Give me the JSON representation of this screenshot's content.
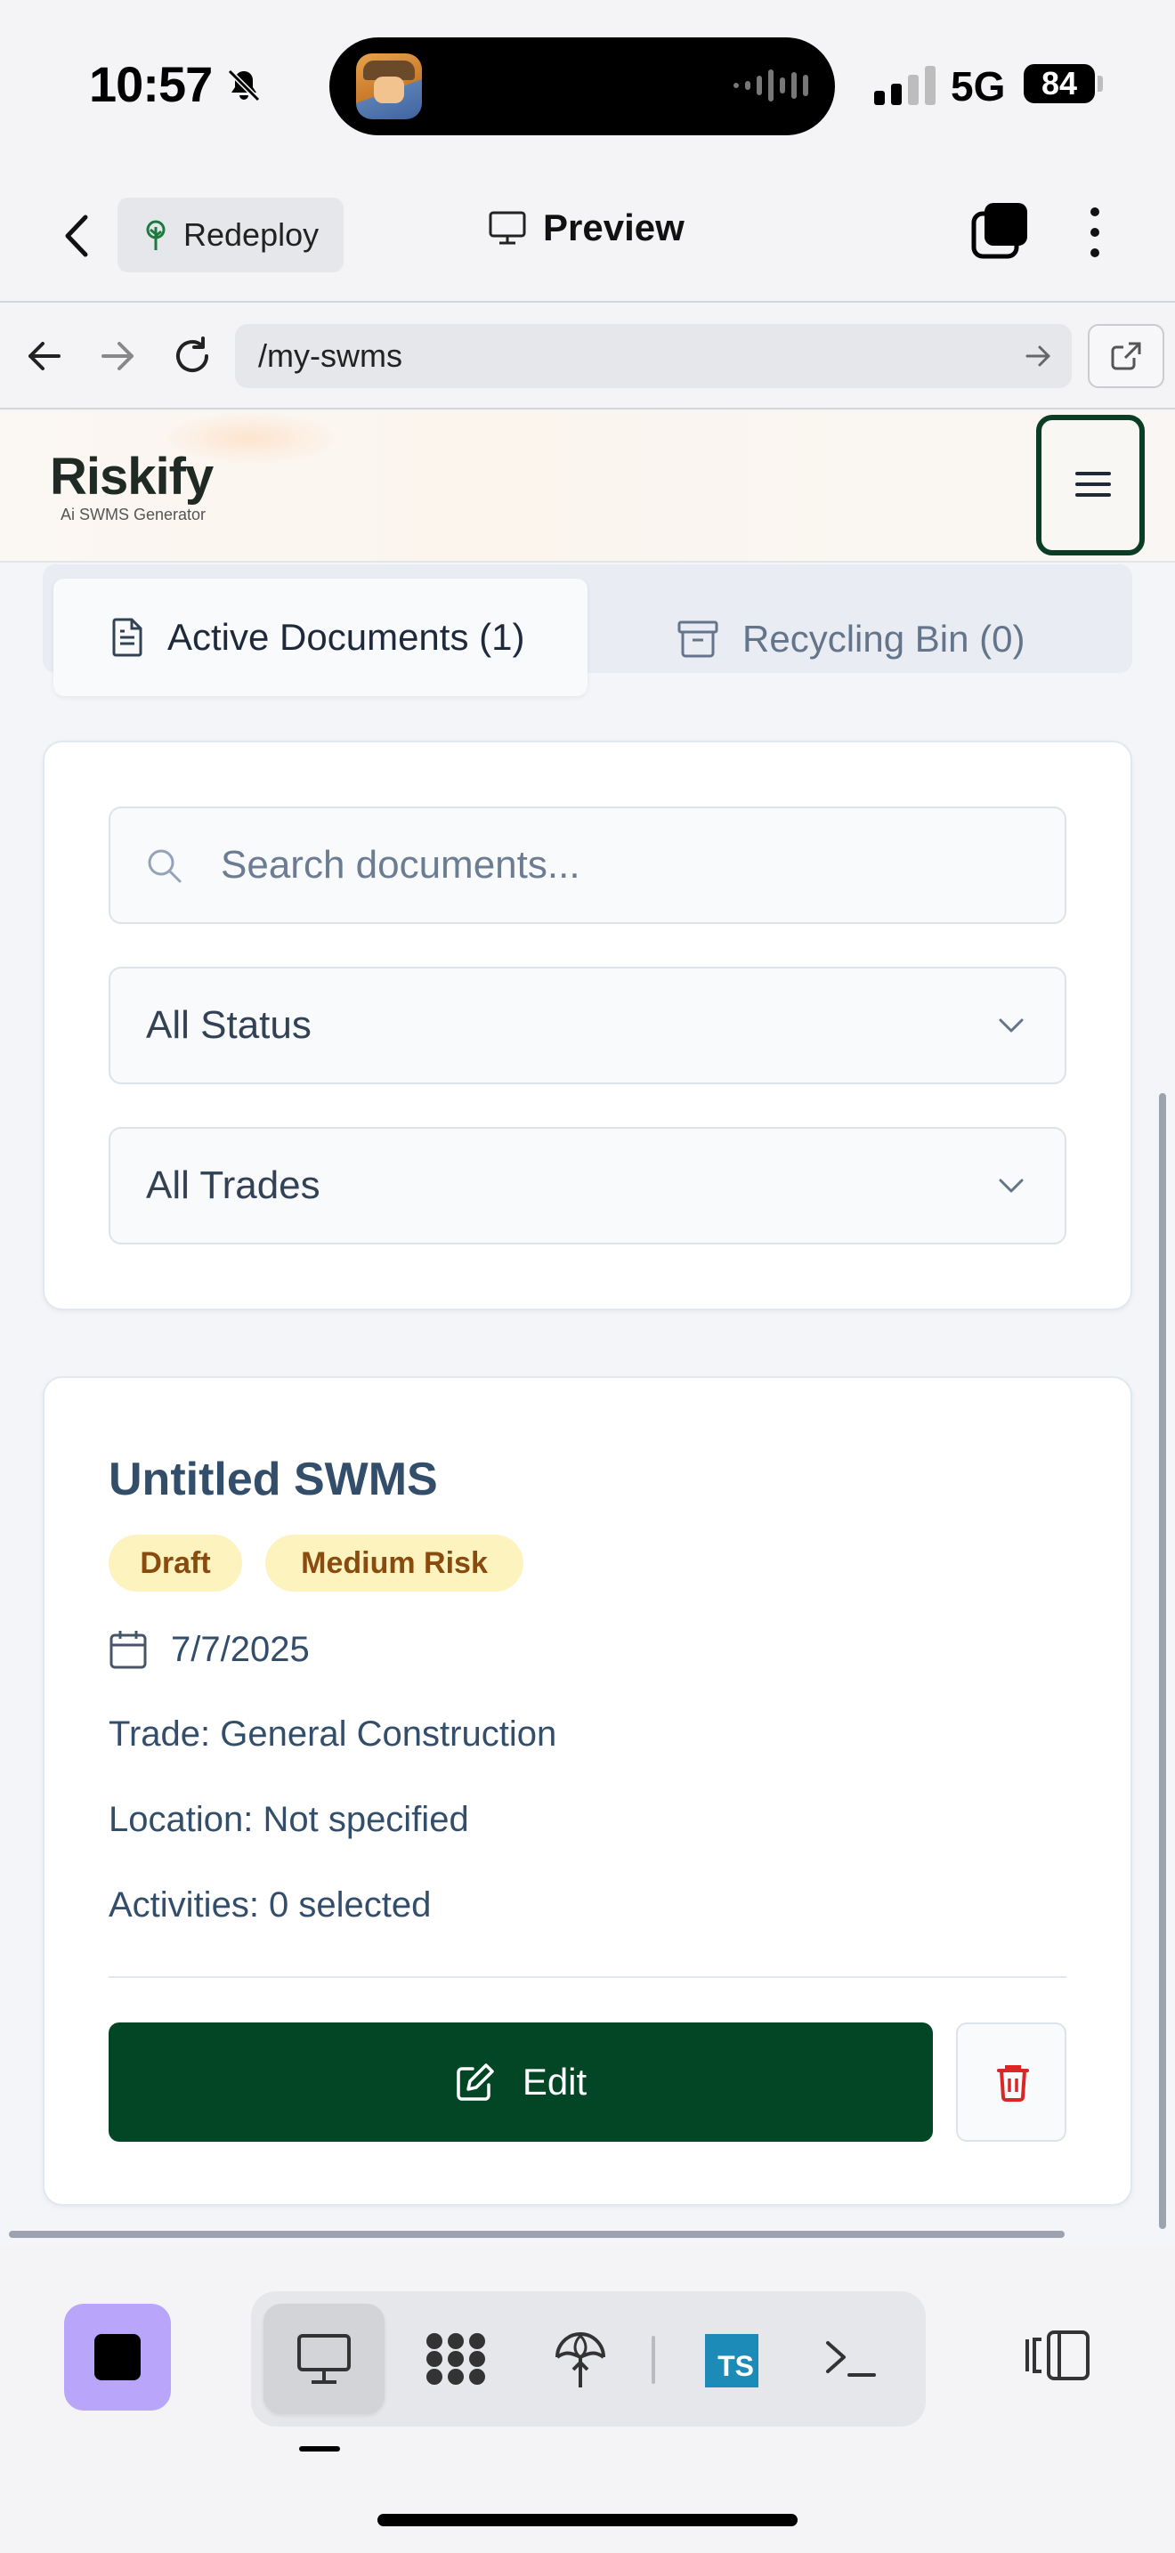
{
  "status_bar": {
    "time": "10:57",
    "network": "5G",
    "battery": "84"
  },
  "app_header": {
    "redeploy_label": "Redeploy",
    "preview_label": "Preview"
  },
  "browser": {
    "url": "/my-swms"
  },
  "site": {
    "logo_text": "Riskify",
    "logo_tagline": "Ai SWMS Generator"
  },
  "tabs": [
    {
      "label": "Active Documents (1)",
      "active": true
    },
    {
      "label": "Recycling Bin (0)",
      "active": false
    }
  ],
  "filters": {
    "search_placeholder": "Search documents...",
    "status_value": "All Status",
    "trades_value": "All Trades"
  },
  "document": {
    "title": "Untitled SWMS",
    "badges": [
      "Draft",
      "Medium Risk"
    ],
    "date": "7/7/2025",
    "trade": "Trade: General Construction",
    "location": "Location: Not specified",
    "activities": "Activities: 0 selected",
    "edit_label": "Edit"
  },
  "toolbar": {
    "ts_label": "TS",
    "terminal_label": ">_"
  },
  "colors": {
    "brand_green": "#034626",
    "badge_bg": "#fdf3bf",
    "badge_text": "#8a4b0f",
    "delete_red": "#dc2626",
    "stop_button": "#b9a6fb",
    "typescript_blue": "#1d8bb8"
  }
}
